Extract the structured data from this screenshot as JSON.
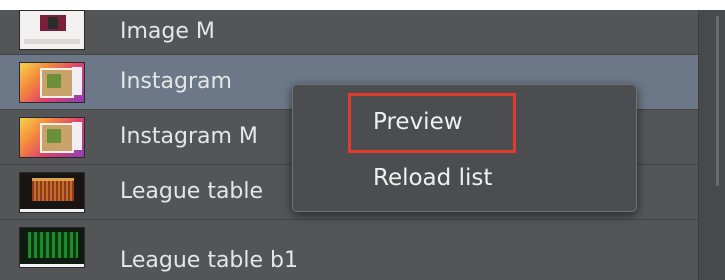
{
  "list": {
    "items": [
      {
        "label": "Image M",
        "thumbnail": "image-m-thumbnail-icon",
        "selected": false
      },
      {
        "label": "Instagram",
        "thumbnail": "instagram-thumbnail-icon",
        "selected": true
      },
      {
        "label": "Instagram M",
        "thumbnail": "instagram-thumbnail-icon",
        "selected": false
      },
      {
        "label": "League table",
        "thumbnail": "league-table-thumbnail-icon",
        "selected": false
      },
      {
        "label": "League table b1",
        "thumbnail": "league-table-b1-thumbnail-icon",
        "selected": false
      }
    ]
  },
  "context_menu": {
    "items": [
      {
        "label": "Preview",
        "highlighted": true
      },
      {
        "label": "Reload list",
        "highlighted": false
      }
    ]
  },
  "colors": {
    "panel_bg": "#545557",
    "selected_row": "#6c7887",
    "menu_bg": "#4c4d50",
    "highlight_box": "#e23b2e"
  }
}
